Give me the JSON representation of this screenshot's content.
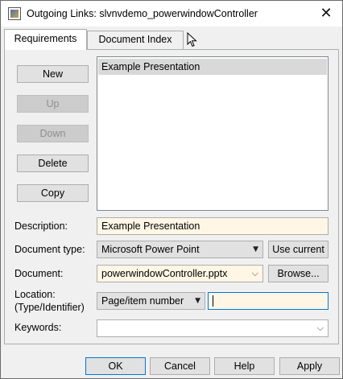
{
  "window": {
    "title": "Outgoing Links: slvnvdemo_powerwindowController",
    "close_glyph": "✕"
  },
  "tabs": [
    {
      "label": "Requirements",
      "active": true
    },
    {
      "label": "Document Index",
      "active": false
    }
  ],
  "requirements": {
    "buttons": {
      "new": "New",
      "up": "Up",
      "down": "Down",
      "delete": "Delete",
      "copy": "Copy"
    },
    "list_items": [
      "Example Presentation"
    ]
  },
  "form": {
    "description_label": "Description:",
    "description_value": "Example Presentation",
    "doctype_label": "Document type:",
    "doctype_value": "Microsoft Power Point",
    "use_current": "Use current",
    "document_label": "Document:",
    "document_value": "powerwindowController.pptx",
    "browse": "Browse...",
    "location_label_1": "Location:",
    "location_label_2": "(Type/Identifier)",
    "location_type": "Page/item number",
    "location_value": "",
    "keywords_label": "Keywords:",
    "keywords_value": ""
  },
  "footer": {
    "ok": "OK",
    "cancel": "Cancel",
    "help": "Help",
    "apply": "Apply"
  },
  "colors": {
    "cream_field": "#fff6e5",
    "focus_border": "#0078d7",
    "selected_item": "#d9d9d9"
  }
}
